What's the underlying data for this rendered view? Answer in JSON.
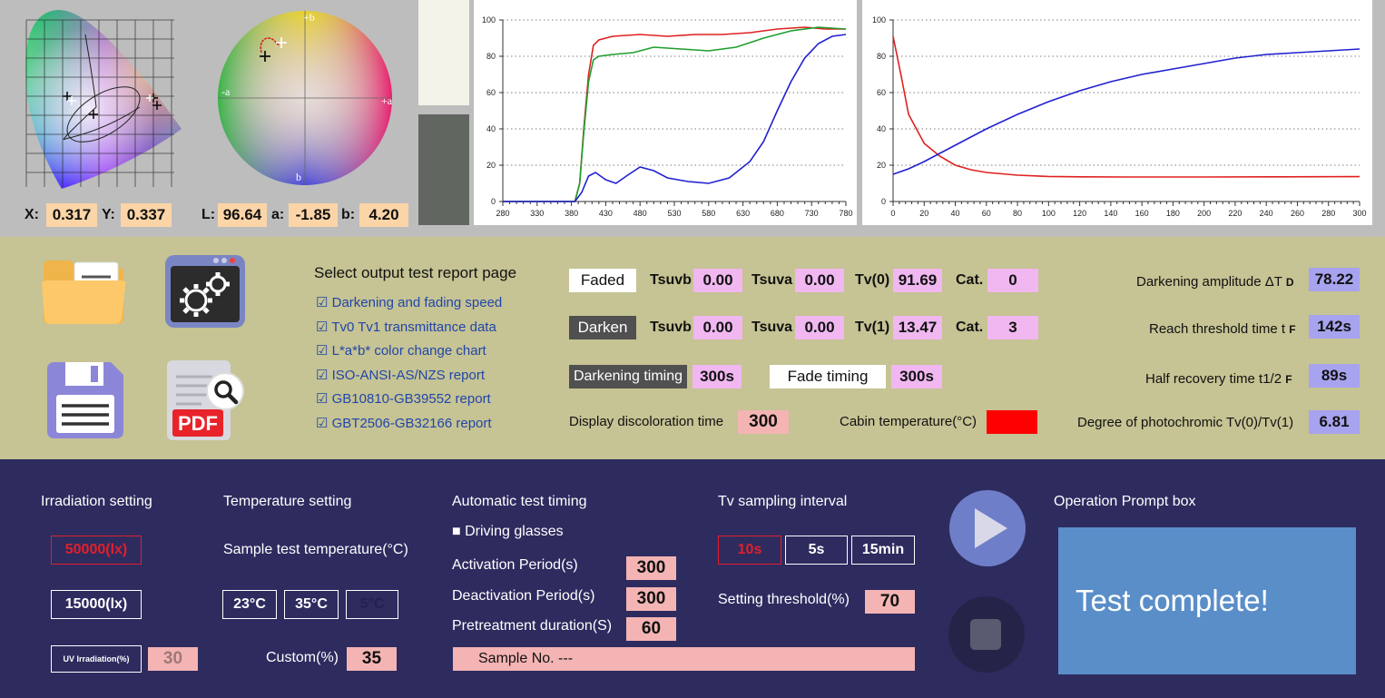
{
  "colorimetry": {
    "x_label": "X:",
    "x_value": "0.317",
    "y_label": "Y:",
    "y_value": "0.337",
    "l_label": "L:",
    "l_value": "96.64",
    "a_label": "a:",
    "a_value": "-1.85",
    "b_label": "b:",
    "b_value": "4.20",
    "lab_axis_b": "+b",
    "lab_axis_a_neg": "-a",
    "lab_axis_a_pos": "+a",
    "lab_axis_b_neg": "b",
    "swatch_colors": [
      "#f3f3ea",
      "#626661"
    ]
  },
  "chart_data": [
    {
      "type": "line",
      "x_ticks": [
        280,
        330,
        380,
        430,
        480,
        530,
        580,
        630,
        680,
        730,
        780
      ],
      "y_ticks": [
        0,
        20,
        40,
        60,
        80,
        100
      ],
      "xlim": [
        280,
        780
      ],
      "ylim": [
        0,
        100
      ],
      "grid": "horizontal-dotted",
      "series": [
        {
          "color": "#e02020",
          "x": [
            280,
            385,
            392,
            398,
            405,
            412,
            420,
            440,
            480,
            520,
            560,
            600,
            640,
            680,
            720,
            750,
            780
          ],
          "y": [
            0,
            0,
            10,
            40,
            70,
            86,
            89,
            91,
            92,
            91,
            92,
            92,
            93,
            95,
            96,
            95,
            95
          ]
        },
        {
          "color": "#1e9e2e",
          "x": [
            280,
            385,
            392,
            398,
            405,
            412,
            420,
            440,
            470,
            500,
            540,
            580,
            620,
            660,
            700,
            740,
            780
          ],
          "y": [
            0,
            0,
            10,
            38,
            66,
            78,
            80,
            81,
            82,
            85,
            84,
            83,
            85,
            90,
            94,
            96,
            95
          ]
        },
        {
          "color": "#2020d0",
          "x": [
            280,
            385,
            395,
            405,
            415,
            430,
            445,
            460,
            480,
            500,
            520,
            550,
            580,
            610,
            640,
            660,
            680,
            700,
            720,
            740,
            760,
            780
          ],
          "y": [
            0,
            0,
            5,
            14,
            16,
            12,
            10,
            14,
            19,
            17,
            13,
            11,
            10,
            13,
            22,
            33,
            50,
            66,
            79,
            87,
            91,
            92
          ]
        }
      ]
    },
    {
      "type": "line",
      "x_ticks": [
        0,
        20,
        40,
        60,
        80,
        100,
        120,
        140,
        160,
        180,
        200,
        220,
        240,
        260,
        280,
        300
      ],
      "y_ticks": [
        0,
        20,
        40,
        60,
        80,
        100
      ],
      "xlim": [
        0,
        300
      ],
      "ylim": [
        0,
        100
      ],
      "grid": "horizontal-dotted",
      "series": [
        {
          "color": "#e02020",
          "x": [
            0,
            5,
            10,
            20,
            30,
            40,
            50,
            60,
            80,
            100,
            120,
            150,
            200,
            250,
            300
          ],
          "y": [
            91,
            70,
            48,
            32,
            25,
            20,
            17.5,
            16,
            14.5,
            13.8,
            13.6,
            13.5,
            13.5,
            13.6,
            13.7
          ]
        },
        {
          "color": "#2020d0",
          "x": [
            0,
            10,
            20,
            40,
            60,
            80,
            100,
            120,
            140,
            160,
            180,
            200,
            220,
            240,
            260,
            280,
            300
          ],
          "y": [
            15,
            18,
            22,
            31,
            40,
            48,
            55,
            61,
            66,
            70,
            73,
            76,
            79,
            81,
            82,
            83,
            84
          ]
        }
      ]
    }
  ],
  "report": {
    "title": "Select output test report page",
    "items": [
      "☑ Darkening and fading speed",
      "☑ Tv0 Tv1 transmittance data",
      "☑ L*a*b* color change chart",
      "☑ ISO-ANSI-AS/NZS report",
      "☑ GB10810-GB39552 report",
      "☑ GBT2506-GB32166 report"
    ]
  },
  "faded": {
    "button": "Faded",
    "tsuvb_label": "Tsuvb",
    "tsuvb": "0.00",
    "tsuva_label": "Tsuva",
    "tsuva": "0.00",
    "tv_label": "Tv(0)",
    "tv": "91.69",
    "cat_label": "Cat.",
    "cat": "0"
  },
  "darken": {
    "button": "Darken",
    "tsuvb_label": "Tsuvb",
    "tsuvb": "0.00",
    "tsuva_label": "Tsuva",
    "tsuva": "0.00",
    "tv_label": "Tv(1)",
    "tv": "13.47",
    "cat_label": "Cat.",
    "cat": "3"
  },
  "timing": {
    "darkening_button": "Darkening timing",
    "darkening_value": "300s",
    "fade_button": "Fade timing",
    "fade_value": "300s",
    "display_label": "Display discoloration time",
    "display_value": "300",
    "cabin_label": "Cabin temperature(°C)",
    "cabin_color": "#ff0000"
  },
  "results": {
    "amplitude_label": "Darkening amplitude ΔT",
    "amplitude_sub": "D",
    "amplitude": "78.22",
    "threshold_label": "Reach threshold time t",
    "threshold_sub": "F",
    "threshold": "142s",
    "half_label": "Half recovery time t1/2",
    "half_sub": "F",
    "half": "89s",
    "degree_label": "Degree of photochromic Tv(0)/Tv(1)",
    "degree": "6.81"
  },
  "icons": {
    "pdf_text": "PDF"
  },
  "irradiation": {
    "title": "Irradiation setting",
    "opt1": "50000(lx)",
    "opt2": "15000(lx)",
    "uv_button": "UV Irradiation(%)",
    "uv_value": "30"
  },
  "temperature": {
    "title": "Temperature setting",
    "sample_label": "Sample test temperature(°C)",
    "t1": "23°C",
    "t2": "35°C",
    "t3": "5°C",
    "custom_label": "Custom(%)",
    "custom_value": "35"
  },
  "auto": {
    "title": "Automatic test timing",
    "driving": "■ Driving glasses",
    "activation_label": "Activation Period(s)",
    "activation": "300",
    "deactivation_label": "Deactivation Period(s)",
    "deactivation": "300",
    "pretreat_label": "Pretreatment duration(S)",
    "pretreat": "60",
    "sample_no": "Sample No. ---"
  },
  "sampling": {
    "title": "Tv sampling interval",
    "i1": "10s",
    "i2": "5s",
    "i3": "15min",
    "threshold_label": "Setting threshold(%)",
    "threshold": "70"
  },
  "prompt": {
    "title": "Operation Prompt box",
    "message": "Test complete!"
  }
}
